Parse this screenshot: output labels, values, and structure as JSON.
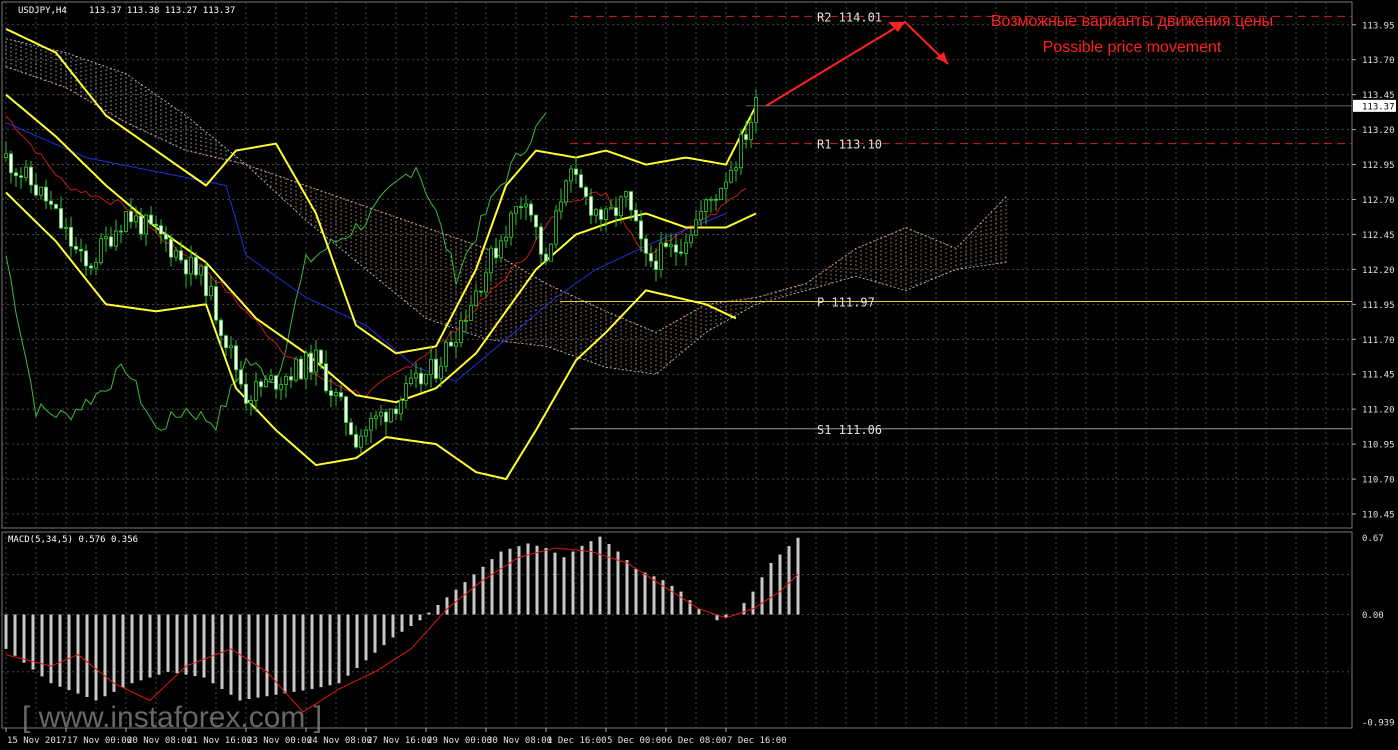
{
  "chart_data": {
    "type": "line",
    "symbol_header": "USDJPY,H4",
    "ohlc_header": "113.37 113.38 113.27 113.37",
    "current_price": 113.37,
    "current_price_label": "113.37",
    "price_axis": {
      "ylim": [
        110.35,
        114.07
      ],
      "ticks": [
        110.45,
        110.7,
        110.95,
        111.2,
        111.45,
        111.7,
        111.95,
        112.2,
        112.45,
        112.7,
        112.95,
        113.2,
        113.45,
        113.7,
        113.95
      ],
      "tick_labels": [
        "110.45",
        "110.70",
        "110.95",
        "111.20",
        "111.45",
        "111.70",
        "111.95",
        "112.20",
        "112.45",
        "112.70",
        "112.95",
        "113.20",
        "113.45",
        "113.70",
        "113.95"
      ]
    },
    "x_axis": {
      "n_bars": 158,
      "labels": [
        {
          "bar": 0,
          "text": "15 Nov 2017"
        },
        {
          "bar": 12,
          "text": "17 Nov 00:00"
        },
        {
          "bar": 24,
          "text": "20 Nov 08:00"
        },
        {
          "bar": 36,
          "text": "21 Nov 16:00"
        },
        {
          "bar": 48,
          "text": "23 Nov 00:00"
        },
        {
          "bar": 60,
          "text": "24 Nov 08:00"
        },
        {
          "bar": 72,
          "text": "27 Nov 16:00"
        },
        {
          "bar": 84,
          "text": "29 Nov 00:00"
        },
        {
          "bar": 96,
          "text": "30 Nov 08:00"
        },
        {
          "bar": 108,
          "text": "1 Dec 16:00"
        },
        {
          "bar": 120,
          "text": "5 Dec 00:00"
        },
        {
          "bar": 132,
          "text": "6 Dec 08:00"
        },
        {
          "bar": 144,
          "text": "7 Dec 16:00"
        }
      ]
    },
    "levels": [
      {
        "name": "R2",
        "label": "R2 114.01",
        "value": 114.01,
        "style": "dashed"
      },
      {
        "name": "R1",
        "label": "R1 113.10",
        "value": 113.1,
        "style": "dashed"
      },
      {
        "name": "P",
        "label": "P 111.97",
        "value": 111.97,
        "style": "solid"
      },
      {
        "name": "S1",
        "label": "S1 111.06",
        "value": 111.06,
        "style": "solid"
      }
    ],
    "annotation": {
      "line1": "Возможные варианты движения цены",
      "line2": "Possible price movement"
    },
    "close_path": [
      [
        0,
        113.0
      ],
      [
        8,
        112.7
      ],
      [
        16,
        112.2
      ],
      [
        24,
        112.6
      ],
      [
        32,
        112.4
      ],
      [
        40,
        112.1
      ],
      [
        48,
        111.3
      ],
      [
        56,
        111.45
      ],
      [
        62,
        111.55
      ],
      [
        70,
        111.0
      ],
      [
        78,
        111.25
      ],
      [
        86,
        111.5
      ],
      [
        92,
        111.9
      ],
      [
        100,
        112.5
      ],
      [
        104,
        112.75
      ],
      [
        108,
        112.2
      ],
      [
        112,
        112.9
      ],
      [
        116,
        112.7
      ],
      [
        120,
        112.55
      ],
      [
        124,
        112.7
      ],
      [
        128,
        112.25
      ],
      [
        134,
        112.35
      ],
      [
        138,
        112.55
      ],
      [
        142,
        112.75
      ],
      [
        146,
        113.0
      ],
      [
        150,
        113.37
      ]
    ],
    "bollinger": {
      "upper": [
        [
          0,
          113.92
        ],
        [
          10,
          113.75
        ],
        [
          20,
          113.3
        ],
        [
          30,
          113.05
        ],
        [
          40,
          112.8
        ],
        [
          46,
          113.05
        ],
        [
          54,
          113.1
        ],
        [
          62,
          112.6
        ],
        [
          70,
          111.8
        ],
        [
          78,
          111.6
        ],
        [
          86,
          111.65
        ],
        [
          94,
          112.2
        ],
        [
          100,
          112.8
        ],
        [
          106,
          113.05
        ],
        [
          114,
          113.0
        ],
        [
          120,
          113.05
        ],
        [
          128,
          112.95
        ],
        [
          136,
          113.0
        ],
        [
          144,
          112.95
        ],
        [
          150,
          113.37
        ]
      ],
      "middle": [
        [
          0,
          113.45
        ],
        [
          10,
          113.15
        ],
        [
          20,
          112.8
        ],
        [
          30,
          112.5
        ],
        [
          40,
          112.25
        ],
        [
          50,
          111.85
        ],
        [
          60,
          111.6
        ],
        [
          70,
          111.3
        ],
        [
          78,
          111.25
        ],
        [
          86,
          111.35
        ],
        [
          94,
          111.6
        ],
        [
          100,
          111.9
        ],
        [
          106,
          112.2
        ],
        [
          114,
          112.45
        ],
        [
          122,
          112.55
        ],
        [
          128,
          112.6
        ],
        [
          136,
          112.5
        ],
        [
          144,
          112.5
        ],
        [
          150,
          112.6
        ]
      ],
      "lower": [
        [
          0,
          112.75
        ],
        [
          10,
          112.4
        ],
        [
          20,
          111.95
        ],
        [
          30,
          111.9
        ],
        [
          40,
          111.95
        ],
        [
          46,
          111.35
        ],
        [
          54,
          111.05
        ],
        [
          62,
          110.8
        ],
        [
          70,
          110.85
        ],
        [
          76,
          111.0
        ],
        [
          86,
          110.95
        ],
        [
          94,
          110.75
        ],
        [
          100,
          110.7
        ],
        [
          106,
          111.05
        ],
        [
          114,
          111.55
        ],
        [
          120,
          111.75
        ],
        [
          128,
          112.05
        ],
        [
          134,
          112.0
        ],
        [
          140,
          111.95
        ],
        [
          146,
          111.85
        ]
      ]
    },
    "ichimoku": {
      "tenkan": [
        [
          0,
          113.3
        ],
        [
          12,
          112.8
        ],
        [
          24,
          112.65
        ],
        [
          32,
          112.4
        ],
        [
          40,
          112.2
        ],
        [
          48,
          111.9
        ],
        [
          56,
          111.6
        ],
        [
          64,
          111.4
        ],
        [
          72,
          111.3
        ],
        [
          80,
          111.5
        ],
        [
          88,
          111.7
        ],
        [
          96,
          112.0
        ],
        [
          104,
          112.3
        ],
        [
          112,
          112.7
        ],
        [
          120,
          112.75
        ],
        [
          128,
          112.3
        ],
        [
          136,
          112.5
        ],
        [
          142,
          112.6
        ],
        [
          148,
          112.8
        ]
      ],
      "kijun": [
        [
          0,
          113.25
        ],
        [
          16,
          113.0
        ],
        [
          30,
          112.9
        ],
        [
          44,
          112.8
        ],
        [
          48,
          112.3
        ],
        [
          60,
          112.0
        ],
        [
          72,
          111.8
        ],
        [
          82,
          111.5
        ],
        [
          90,
          111.4
        ],
        [
          100,
          111.7
        ],
        [
          110,
          112.0
        ],
        [
          118,
          112.2
        ],
        [
          130,
          112.4
        ],
        [
          144,
          112.6
        ]
      ],
      "chikou": [
        [
          0,
          112.3
        ],
        [
          6,
          111.2
        ],
        [
          12,
          111.15
        ],
        [
          18,
          111.3
        ],
        [
          24,
          111.5
        ],
        [
          30,
          111.05
        ],
        [
          36,
          111.2
        ],
        [
          42,
          111.1
        ],
        [
          48,
          111.55
        ],
        [
          54,
          111.4
        ],
        [
          60,
          112.25
        ],
        [
          66,
          112.4
        ],
        [
          72,
          112.55
        ],
        [
          78,
          112.8
        ],
        [
          82,
          112.95
        ],
        [
          86,
          112.6
        ],
        [
          90,
          112.15
        ],
        [
          94,
          112.45
        ],
        [
          98,
          112.75
        ],
        [
          104,
          113.1
        ],
        [
          108,
          113.3
        ]
      ],
      "span_a": [
        [
          0,
          113.65
        ],
        [
          12,
          113.5
        ],
        [
          24,
          113.25
        ],
        [
          36,
          113.05
        ],
        [
          48,
          112.95
        ],
        [
          60,
          112.8
        ],
        [
          72,
          112.65
        ],
        [
          84,
          112.5
        ],
        [
          96,
          112.35
        ],
        [
          108,
          112.1
        ],
        [
          120,
          111.9
        ],
        [
          130,
          111.75
        ],
        [
          140,
          111.95
        ],
        [
          150,
          112.0
        ],
        [
          160,
          112.1
        ],
        [
          170,
          112.35
        ],
        [
          180,
          112.5
        ],
        [
          190,
          112.35
        ],
        [
          200,
          112.72
        ]
      ],
      "span_b": [
        [
          0,
          113.85
        ],
        [
          12,
          113.75
        ],
        [
          24,
          113.6
        ],
        [
          36,
          113.3
        ],
        [
          48,
          112.95
        ],
        [
          60,
          112.55
        ],
        [
          72,
          112.2
        ],
        [
          84,
          111.85
        ],
        [
          96,
          111.7
        ],
        [
          108,
          111.65
        ],
        [
          120,
          111.5
        ],
        [
          130,
          111.45
        ],
        [
          140,
          111.75
        ],
        [
          150,
          111.95
        ],
        [
          160,
          112.05
        ],
        [
          170,
          112.15
        ],
        [
          180,
          112.05
        ],
        [
          190,
          112.2
        ],
        [
          200,
          112.25
        ]
      ]
    },
    "macd": {
      "label": "MACD(5,34,5) 0.576 0.356",
      "ylim": [
        -0.99,
        0.72
      ],
      "ticks": [
        0.67,
        0.0,
        -0.939
      ],
      "tick_labels": [
        "0.67",
        "0.00",
        "-0.939"
      ],
      "histogram": [
        [
          0,
          -0.3
        ],
        [
          10,
          -0.6
        ],
        [
          20,
          -0.75
        ],
        [
          28,
          -0.6
        ],
        [
          36,
          -0.5
        ],
        [
          44,
          -0.55
        ],
        [
          52,
          -0.75
        ],
        [
          60,
          -0.7
        ],
        [
          68,
          -0.65
        ],
        [
          74,
          -0.6
        ],
        [
          80,
          -0.4
        ],
        [
          86,
          -0.2
        ],
        [
          92,
          -0.05
        ],
        [
          98,
          0.15
        ],
        [
          104,
          0.35
        ],
        [
          110,
          0.55
        ],
        [
          116,
          0.62
        ],
        [
          120,
          0.58
        ],
        [
          124,
          0.5
        ],
        [
          128,
          0.6
        ],
        [
          132,
          0.68
        ],
        [
          136,
          0.55
        ],
        [
          140,
          0.4
        ],
        [
          146,
          0.3
        ],
        [
          150,
          0.2
        ],
        [
          154,
          0.05
        ],
        [
          158,
          -0.05
        ],
        [
          162,
          0.0
        ],
        [
          166,
          0.2
        ],
        [
          170,
          0.45
        ],
        [
          176,
          0.67
        ]
      ],
      "signal": [
        [
          0,
          -0.35
        ],
        [
          10,
          -0.45
        ],
        [
          16,
          -0.35
        ],
        [
          24,
          -0.6
        ],
        [
          32,
          -0.75
        ],
        [
          40,
          -0.45
        ],
        [
          50,
          -0.3
        ],
        [
          58,
          -0.5
        ],
        [
          66,
          -0.85
        ],
        [
          74,
          -0.65
        ],
        [
          82,
          -0.5
        ],
        [
          90,
          -0.3
        ],
        [
          98,
          0.05
        ],
        [
          106,
          0.3
        ],
        [
          114,
          0.5
        ],
        [
          122,
          0.58
        ],
        [
          130,
          0.55
        ],
        [
          138,
          0.45
        ],
        [
          146,
          0.25
        ],
        [
          154,
          0.05
        ],
        [
          160,
          -0.03
        ],
        [
          166,
          0.05
        ],
        [
          172,
          0.2
        ],
        [
          176,
          0.35
        ]
      ]
    },
    "watermark": "[ www.instaforex.com ]"
  }
}
